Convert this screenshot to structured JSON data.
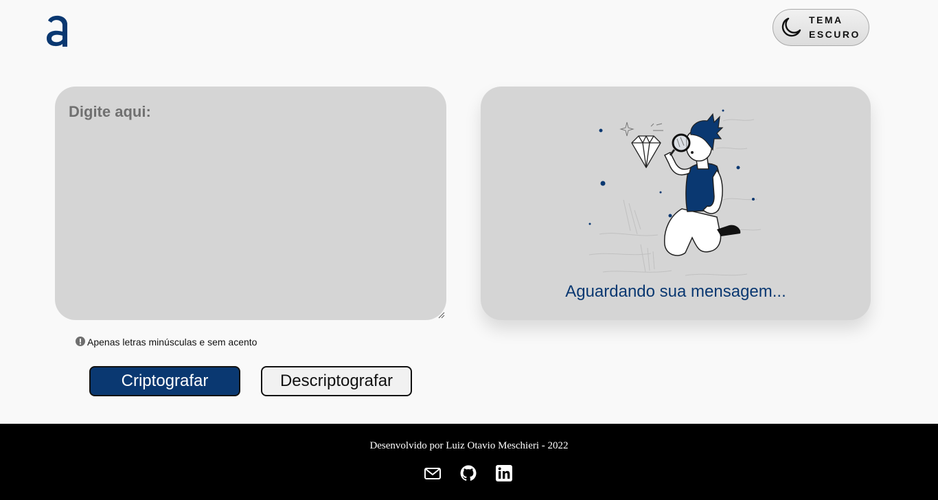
{
  "header": {
    "logo_icon": "alura-a-logo",
    "theme_toggle": {
      "icon": "moon-icon",
      "line1": "TEMA",
      "line2": "ESCURO"
    }
  },
  "input": {
    "placeholder": "Digite aqui:",
    "value": ""
  },
  "output": {
    "illustration": "person-with-magnifying-glass-and-diamond",
    "message": "Aguardando sua mensagem..."
  },
  "hint": {
    "icon": "info-icon",
    "text": "Apenas letras minúsculas e sem acento"
  },
  "buttons": {
    "encrypt_label": "Criptografar",
    "decrypt_label": "Descriptografar"
  },
  "footer": {
    "credit": "Desenvolvido por Luiz Otavio Meschieri - 2022",
    "social": [
      "mail-icon",
      "github-icon",
      "linkedin-icon"
    ]
  },
  "colors": {
    "accent": "#0a3871",
    "card_bg": "#d5d5d5",
    "page_bg": "#f9f9f9",
    "footer_bg": "#000000"
  }
}
